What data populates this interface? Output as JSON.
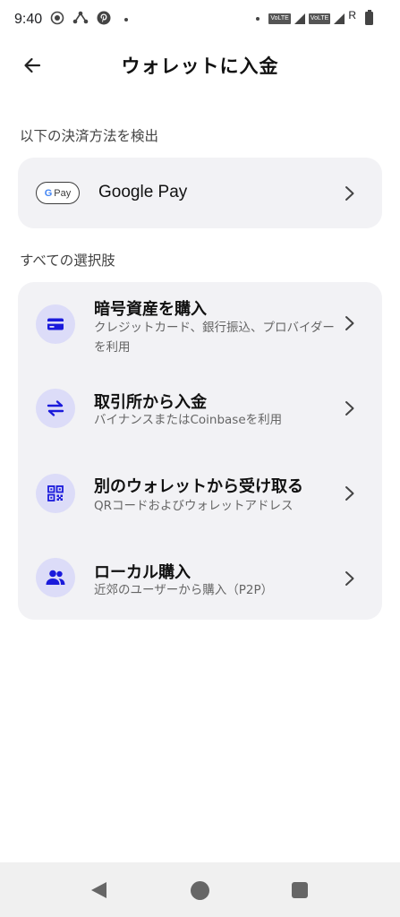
{
  "status_bar": {
    "time": "9:40",
    "volte_label": "VoLTE",
    "roaming": "R"
  },
  "header": {
    "title": "ウォレットに入金"
  },
  "detected": {
    "label": "以下の決済方法を検出",
    "google_pay": {
      "badge_g": "G",
      "badge_text": "Pay",
      "name": "Google Pay"
    }
  },
  "options": {
    "label": "すべての選択肢",
    "items": [
      {
        "title": "暗号資産を購入",
        "subtitle": "クレジットカード、銀行振込、プロバイダーを利用",
        "icon": "card-icon"
      },
      {
        "title": "取引所から入金",
        "subtitle": "バイナンスまたはCoinbaseを利用",
        "icon": "exchange-icon"
      },
      {
        "title": "別のウォレットから受け取る",
        "subtitle": "QRコードおよびウォレットアドレス",
        "icon": "qr-code-icon"
      },
      {
        "title": "ローカル購入",
        "subtitle": "近郊のユーザーから購入（P2P）",
        "icon": "people-icon"
      }
    ]
  },
  "colors": {
    "accent": "#1a1adb",
    "icon_bg": "#dcdcf8",
    "card_bg": "#f2f2f5"
  }
}
